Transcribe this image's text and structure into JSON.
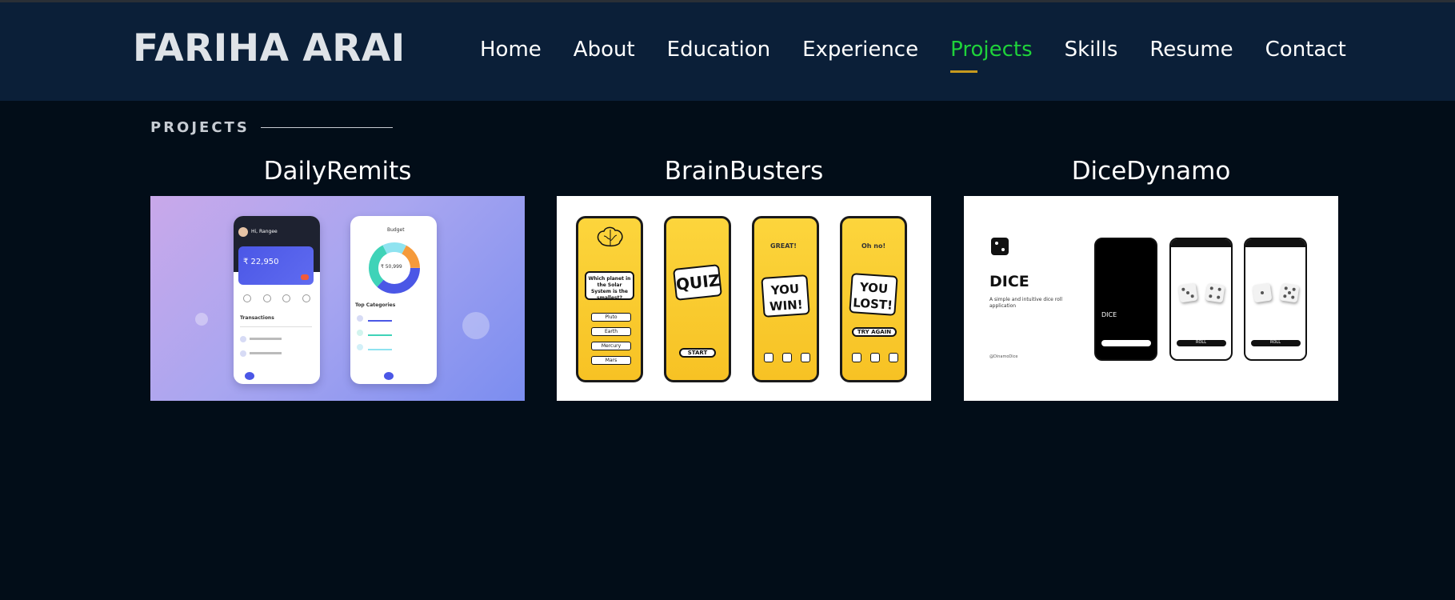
{
  "header": {
    "logo": "FARIHA ARAI",
    "nav": [
      "Home",
      "About",
      "Education",
      "Experience",
      "Projects",
      "Skills",
      "Resume",
      "Contact"
    ],
    "active_nav": "Projects"
  },
  "section": {
    "label": "PROJECTS"
  },
  "projects": [
    {
      "title": "DailyRemits",
      "mock": {
        "greeting": "Hi, Rangee",
        "balance": "₹ 22,950",
        "budget_title": "Budget",
        "budget_amount": "₹ 50,999",
        "top_categories": "Top Categories",
        "transactions": "Transactions"
      }
    },
    {
      "title": "BrainBusters",
      "mock": {
        "question": "Which planet in the Solar System is the smallest?",
        "options": [
          "Pluto",
          "Earth",
          "Mercury",
          "Mars"
        ],
        "quiz": "QUIZ",
        "start": "START",
        "great": "GREAT!",
        "you_win": "YOU WIN!",
        "oh_no": "Oh no!",
        "you_lost": "YOU LOST!",
        "try_again": "TRY AGAIN"
      }
    },
    {
      "title": "DiceDynamo",
      "mock": {
        "heading": "DICE",
        "tagline": "A simple and intuitive dice roll application",
        "handle": "@DinamoDice",
        "phone_title": "DICE",
        "button": "ROLL"
      }
    }
  ],
  "colors": {
    "page_bg": "#020d18",
    "navbar_bg": "#0b1f38",
    "active_link": "#1fd23a",
    "active_underline": "#c79a1e"
  }
}
